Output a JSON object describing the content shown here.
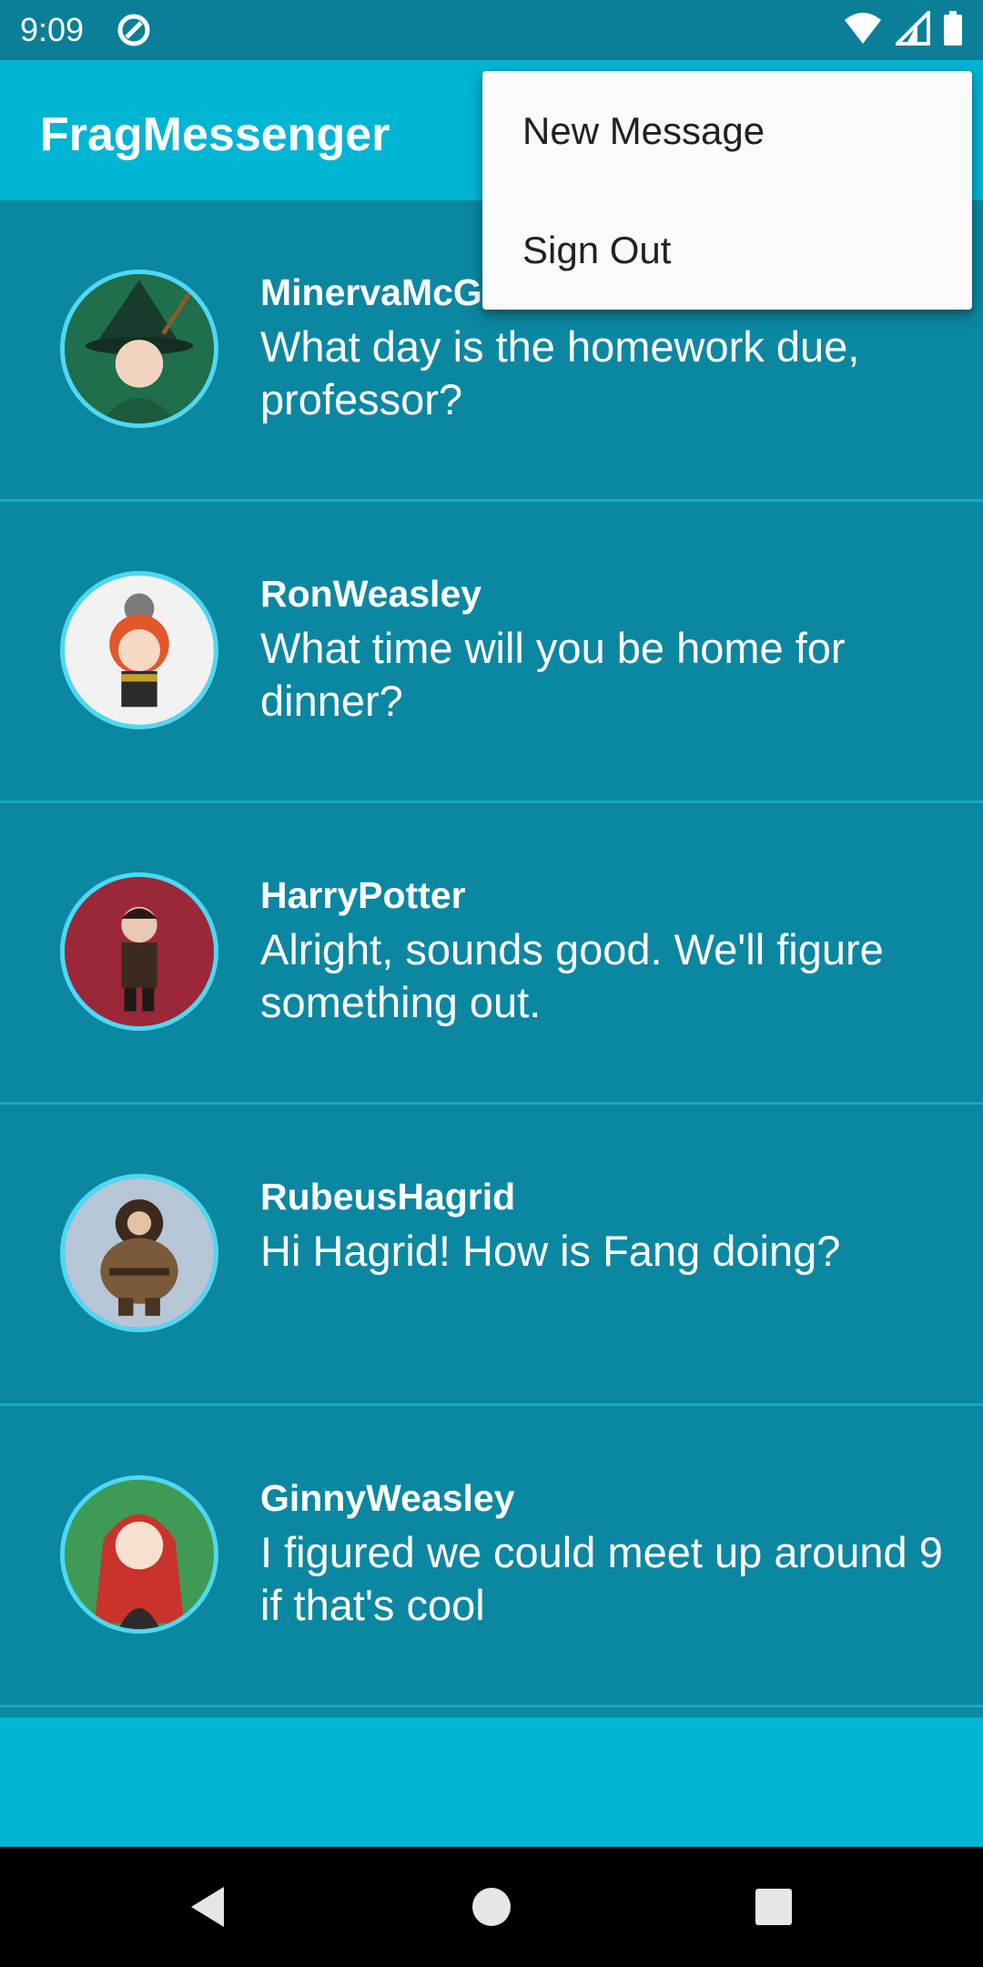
{
  "status": {
    "time": "9:09"
  },
  "app": {
    "title": "FragMessenger"
  },
  "menu": {
    "items": [
      "New Message",
      "Sign Out"
    ]
  },
  "conversations": [
    {
      "name": "MinervaMcG",
      "message": "What day is the homework due, professor?",
      "avatar_color": "#1f6e4c"
    },
    {
      "name": "RonWeasley",
      "message": "What time will you be home for dinner?",
      "avatar_color": "#f2f2f2"
    },
    {
      "name": "HarryPotter",
      "message": "Alright, sounds good. We'll figure something out.",
      "avatar_color": "#9b2838"
    },
    {
      "name": "RubeusHagrid",
      "message": "Hi Hagrid! How is Fang doing?",
      "avatar_color": "#b7c6d6"
    },
    {
      "name": "GinnyWeasley",
      "message": "I figured we could meet up around 9 if that's cool",
      "avatar_color": "#3f9a55"
    }
  ],
  "icons": [
    "app-notification-icon",
    "wifi-icon",
    "signal-icon",
    "battery-icon",
    "back-icon",
    "home-icon",
    "recents-icon"
  ]
}
